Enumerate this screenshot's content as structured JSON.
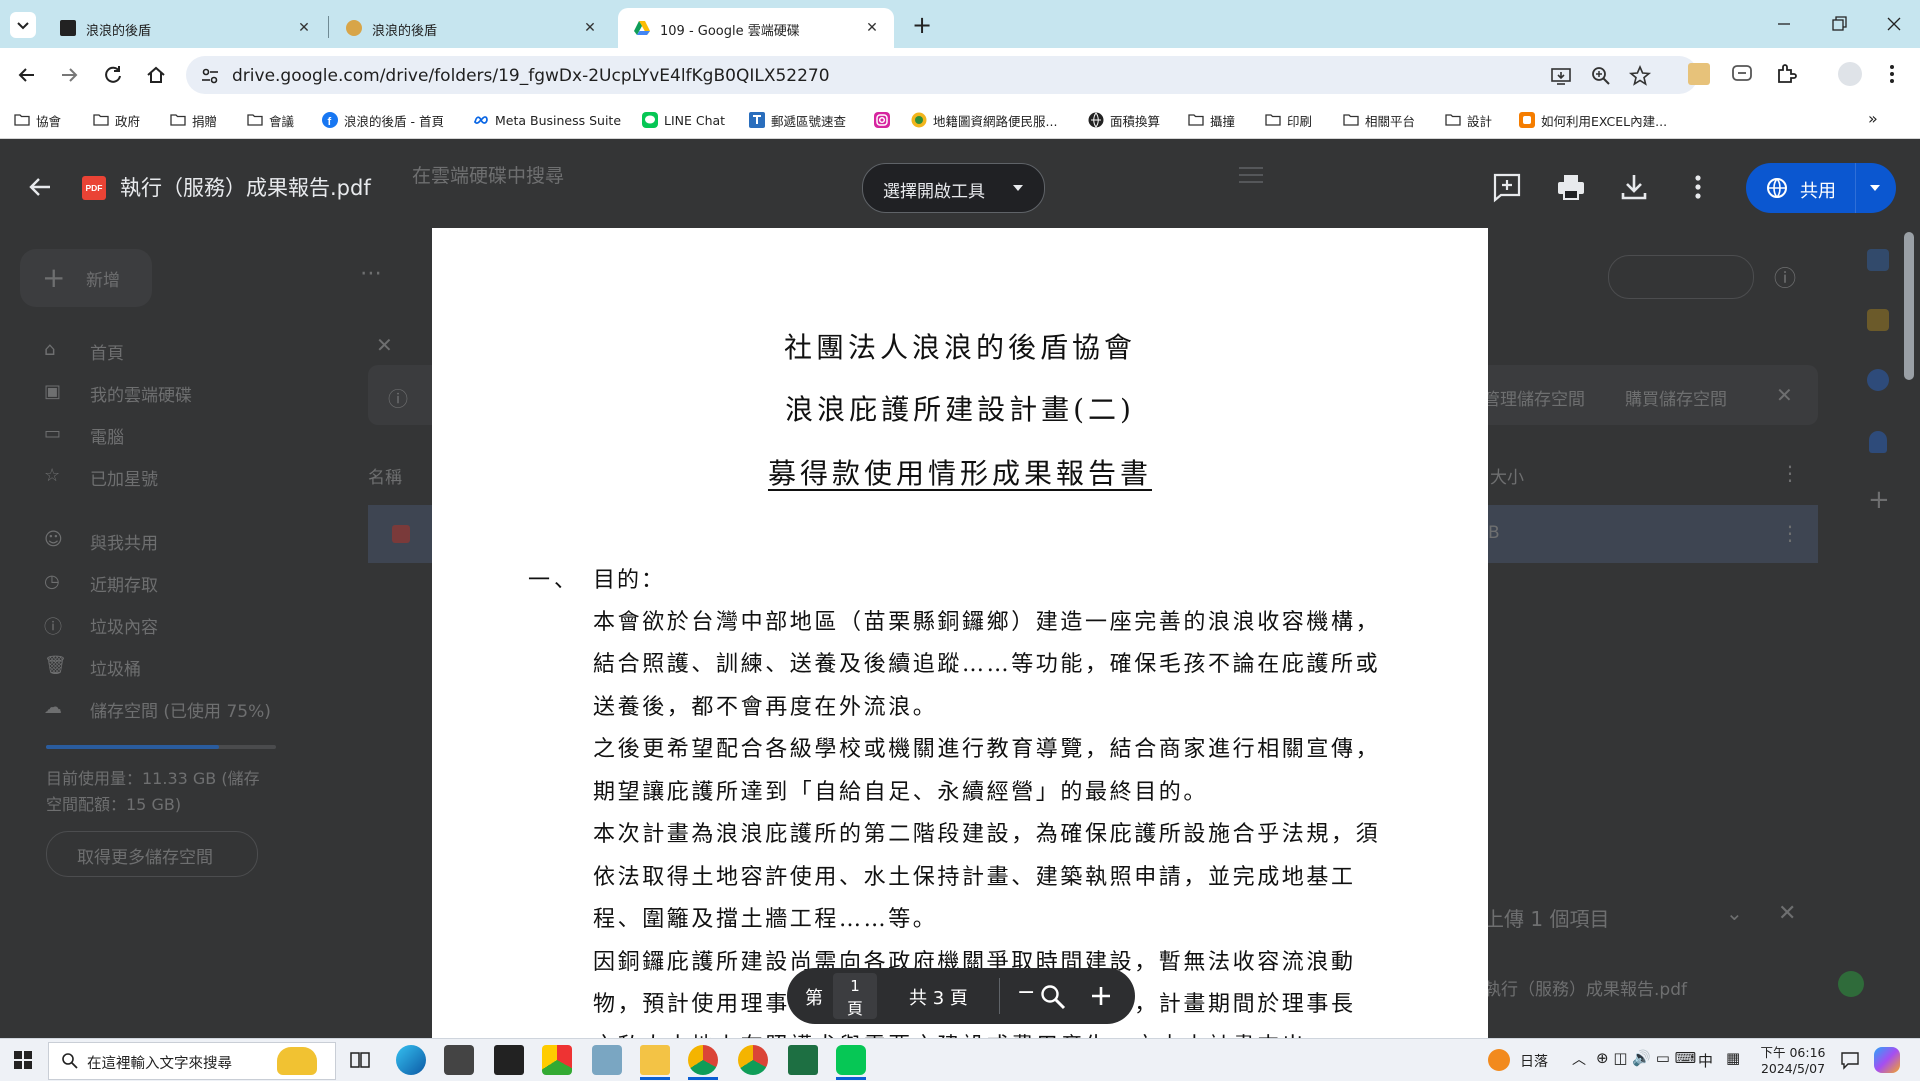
{
  "browser": {
    "tabs": [
      {
        "title": "浪浪的後盾"
      },
      {
        "title": "浪浪的後盾"
      },
      {
        "title": "109 - Google 雲端硬碟"
      }
    ],
    "url": "drive.google.com/drive/folders/19_fgwDx-2UcpLYvE4lfKgB0QILX52270",
    "bookmarks": [
      "協會",
      "政府",
      "捐贈",
      "會議",
      "浪浪的後盾 - 首頁",
      "Meta Business Suite",
      "LINE Chat",
      "郵遞區號速查",
      "",
      "地籍圖資網路便民服...",
      "面積換算",
      "攝撞",
      "印刷",
      "相關平台",
      "設計",
      "如何利用EXCEL內建..."
    ]
  },
  "drive": {
    "search_placeholder": "在雲端硬碟中搜尋",
    "new_label": "新增",
    "nav": [
      "首頁",
      "我的雲端硬碟",
      "電腦",
      "已加星號",
      "與我共用",
      "近期存取",
      "垃圾內容",
      "垃圾桶",
      "儲存空間 (已使用 75%)"
    ],
    "storage_text_1": "目前使用量：11.33 GB (儲存",
    "storage_text_2": "空間配額：15 GB)",
    "storage_used_fraction": 0.75,
    "get_more_storage": "取得更多儲存空間",
    "col_name": "名稱",
    "col_size": "大小",
    "size_value": "B",
    "banner_manage": "管理儲存空間",
    "banner_buy": "購買儲存空間",
    "upload_title": "上傳 1 個項目",
    "upload_file": "執行（服務）成果報告.pdf"
  },
  "viewer": {
    "file_name": "執行（服務）成果報告.pdf",
    "open_with": "選擇開啟工具",
    "share": "共用",
    "page_label_prefix": "第",
    "page_current": "1",
    "page_label_suffix": "頁",
    "page_total": "共 3 頁"
  },
  "pdf": {
    "title_1": "社團法人浪浪的後盾協會",
    "title_2": "浪浪庇護所建設計畫(二)",
    "title_3": "募得款使用情形成果報告書",
    "section_num": "一、",
    "section_title": "目的：",
    "lines": [
      "本會欲於台灣中部地區（苗栗縣銅鑼鄉）建造一座完善的浪浪收容機構，",
      "結合照護、訓練、送養及後續追蹤……等功能，確保毛孩不論在庇護所或",
      "送養後，都不會再度在外流浪。",
      "之後更希望配合各級學校或機關進行教育導覽，結合商家進行相關宣傳，",
      "期望讓庇護所達到「自給自足、永續經營」的最終目的。",
      "本次計畫為浪浪庇護所的第二階段建設，為確保庇護所設施合乎法規，須",
      "依法取得土地容許使用、水土保持計畫、建築執照申請，並完成地基工",
      "程、圍籬及擋土牆工程……等。",
      "因銅鑼庇護所建設尚需向各政府機關爭取時間建設，暫無法收容流浪動",
      "物，預計使用理事長之私人土地先行收容流浪動物，計畫期間於理事長",
      "之私人土地上在照護犬與需要之建設或費用產生，亦由本計畫支出"
    ]
  },
  "taskbar": {
    "search_placeholder": "在這裡輸入文字來搜尋",
    "weather": "日落",
    "ime": "中",
    "time": "下午 06:16",
    "date": "2024/5/07"
  }
}
